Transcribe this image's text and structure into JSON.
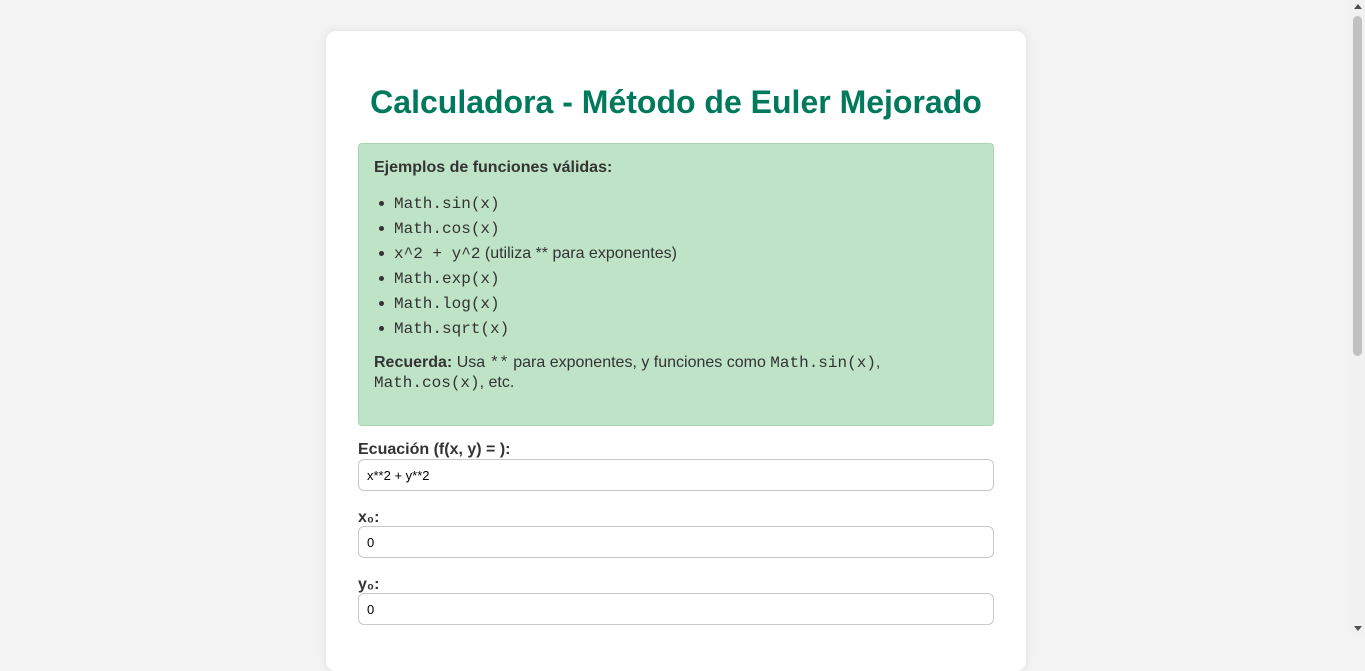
{
  "title": "Calculadora - Método de Euler Mejorado",
  "examples": {
    "heading": "Ejemplos de funciones válidas:",
    "items": [
      {
        "code": "Math.sin(x)",
        "suffix": ""
      },
      {
        "code": "Math.cos(x)",
        "suffix": ""
      },
      {
        "code": "x^2 + y^2",
        "suffix": " (utiliza ** para exponentes)"
      },
      {
        "code": "Math.exp(x)",
        "suffix": ""
      },
      {
        "code": "Math.log(x)",
        "suffix": ""
      },
      {
        "code": "Math.sqrt(x)",
        "suffix": ""
      }
    ],
    "reminder": {
      "label": "Recuerda:",
      "text1": " Usa ",
      "code1": "**",
      "text2": " para exponentes, y funciones como ",
      "code2": "Math.sin(x)",
      "text3": ", ",
      "code3": "Math.cos(x)",
      "text4": ", etc."
    }
  },
  "form": {
    "equation": {
      "label": "Ecuación (f(x, y) = ):",
      "value": "x**2 + y**2"
    },
    "x0": {
      "label": "x₀:",
      "value": "0"
    },
    "y0": {
      "label": "y₀:",
      "value": "0"
    }
  }
}
